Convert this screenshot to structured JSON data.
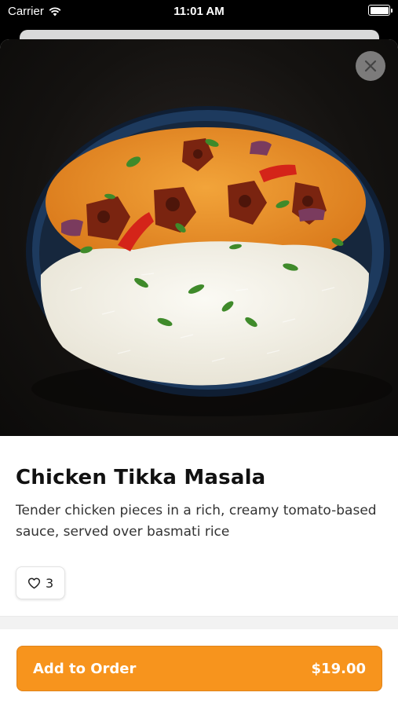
{
  "status_bar": {
    "carrier": "Carrier",
    "time": "11:01 AM"
  },
  "item": {
    "image_alt": "Chicken Tikka Masala with basmati rice",
    "title": "Chicken Tikka Masala",
    "description": "Tender chicken pieces in a rich, creamy tomato-based sauce, served over basmati rice",
    "likes": "3"
  },
  "order": {
    "label": "Add to Order",
    "price": "$19.00"
  },
  "colors": {
    "accent": "#f7941d",
    "background": "#ffffff"
  }
}
